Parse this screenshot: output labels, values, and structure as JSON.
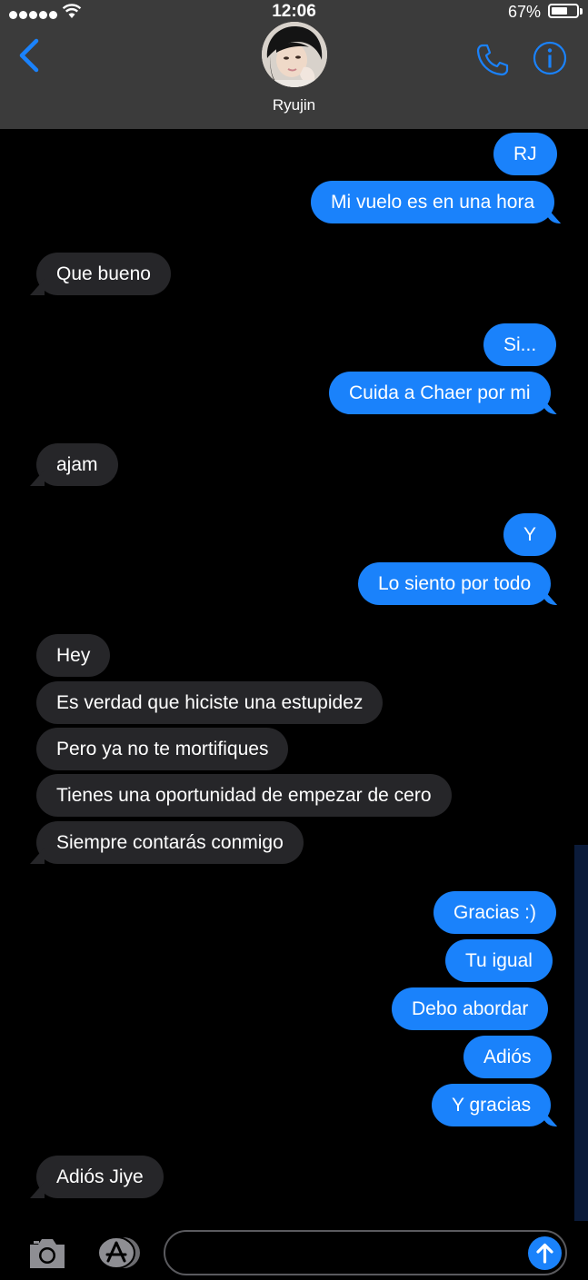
{
  "status_bar": {
    "time": "12:06",
    "battery": "67%",
    "battery_level": 0.67
  },
  "header": {
    "contact_name": "Ryujin",
    "back_icon": "chevron-left-icon",
    "call_icon": "phone-icon",
    "info_icon": "info-icon"
  },
  "colors": {
    "sent_bubble": "#1a82fb",
    "received_bubble": "#262629",
    "header_bg": "#3b3b3b",
    "accent": "#1a82fb"
  },
  "messages": [
    {
      "from": "me",
      "text": "RJ"
    },
    {
      "from": "me",
      "text": "Mi vuelo es en una hora"
    },
    {
      "from": "them",
      "text": "Que bueno"
    },
    {
      "from": "me",
      "text": "Si..."
    },
    {
      "from": "me",
      "text": "Cuida a Chaer por mi"
    },
    {
      "from": "them",
      "text": "ajam"
    },
    {
      "from": "me",
      "text": "Y"
    },
    {
      "from": "me",
      "text": "Lo siento por todo"
    },
    {
      "from": "them",
      "text": "Hey"
    },
    {
      "from": "them",
      "text": "Es verdad que hiciste una estupidez"
    },
    {
      "from": "them",
      "text": "Pero ya no te mortifiques"
    },
    {
      "from": "them",
      "text": "Tienes una oportunidad de empezar de cero"
    },
    {
      "from": "them",
      "text": "Siempre contarás conmigo"
    },
    {
      "from": "me",
      "text": "Gracias :)"
    },
    {
      "from": "me",
      "text": "Tu igual"
    },
    {
      "from": "me",
      "text": "Debo abordar"
    },
    {
      "from": "me",
      "text": "Adiós"
    },
    {
      "from": "me",
      "text": "Y gracias"
    },
    {
      "from": "them",
      "text": "Adiós Jiye"
    }
  ],
  "composer": {
    "value": "",
    "placeholder": "",
    "camera_icon": "camera-icon",
    "apps_icon": "app-store-icon",
    "send_icon": "send-arrow-icon"
  }
}
